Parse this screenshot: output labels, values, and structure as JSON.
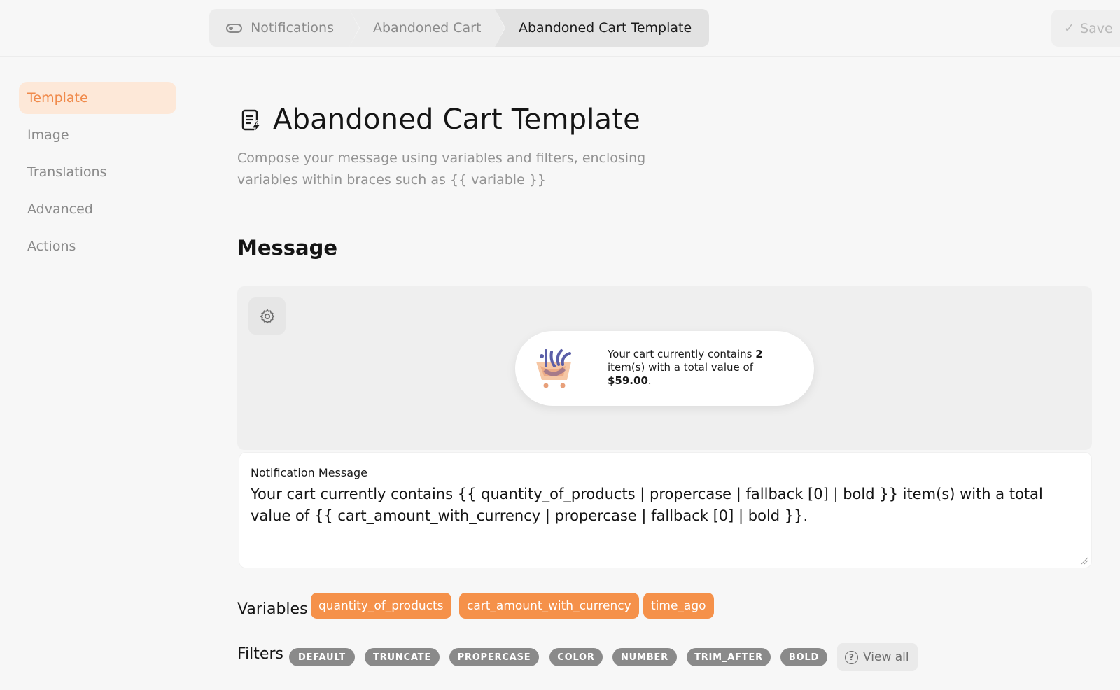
{
  "breadcrumb": {
    "items": [
      "Notifications",
      "Abandoned Cart",
      "Abandoned Cart Template"
    ]
  },
  "toolbar": {
    "save_label": "Save"
  },
  "sidebar": {
    "items": [
      {
        "label": "Template",
        "active": true
      },
      {
        "label": "Image",
        "active": false
      },
      {
        "label": "Translations",
        "active": false
      },
      {
        "label": "Advanced",
        "active": false
      },
      {
        "label": "Actions",
        "active": false
      }
    ]
  },
  "page": {
    "title": "Abandoned Cart Template",
    "description": "Compose your message using variables and filters, enclosing variables within braces such as {{ variable }}"
  },
  "message_section": {
    "title": "Message",
    "preview": {
      "text_before": "Your cart currently contains ",
      "quantity": "2",
      "text_middle": " item(s) with a total value of ",
      "amount": "$59.00",
      "text_after": "."
    },
    "field_label": "Notification Message",
    "field_value": "Your cart currently contains {{ quantity_of_products | propercase | fallback [0] | bold }} item(s) with a total value of {{ cart_amount_with_currency | propercase | fallback [0] | bold }}."
  },
  "variables": {
    "label": "Variables",
    "items": [
      "quantity_of_products",
      "cart_amount_with_currency",
      "time_ago"
    ]
  },
  "filters": {
    "label": "Filters",
    "items": [
      "DEFAULT",
      "TRUNCATE",
      "PROPERCASE",
      "COLOR",
      "NUMBER",
      "TRIM_AFTER",
      "BOLD"
    ],
    "view_all_label": "View all"
  },
  "colors": {
    "accent": "#f5914a",
    "active_bg": "#fde8d8",
    "active_text": "#f08a4b",
    "filter_chip": "#8a8a8a"
  }
}
